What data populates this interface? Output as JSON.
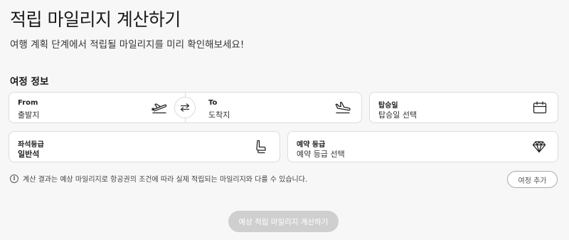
{
  "header": {
    "title": "적립 마일리지 계산하기",
    "subtitle": "여행 계획 단계에서 적립될 마일리지를 미리 확인해보세요!"
  },
  "section_title": "여정 정보",
  "route": {
    "from": {
      "label": "From",
      "value": "출발지",
      "icon": "airplane-takeoff-icon"
    },
    "to": {
      "label": "To",
      "value": "도착지",
      "icon": "airplane-landing-icon"
    },
    "swap_icon": "swap-arrows-icon"
  },
  "date": {
    "label": "탑승일",
    "value": "탑승일 선택",
    "icon": "calendar-icon"
  },
  "seat_class": {
    "label": "좌석등급",
    "value": "일반석",
    "icon": "seat-icon"
  },
  "fare_class": {
    "label": "예약 등급",
    "value": "예약 등급 선택",
    "icon": "diamond-icon"
  },
  "notice": {
    "icon_glyph": "i",
    "text": "계산 결과는 예상 마일리지로 항공권의 조건에 따라 실제 적립되는 마일리지와 다를 수 있습니다."
  },
  "add_trip_button": "여정 추가",
  "calculate_button": "예상 적립 마일리지 계산하기",
  "colors": {
    "background": "#f7f7f7",
    "field_border": "#dcdcdc",
    "disabled_button": "#cfcfcf"
  }
}
